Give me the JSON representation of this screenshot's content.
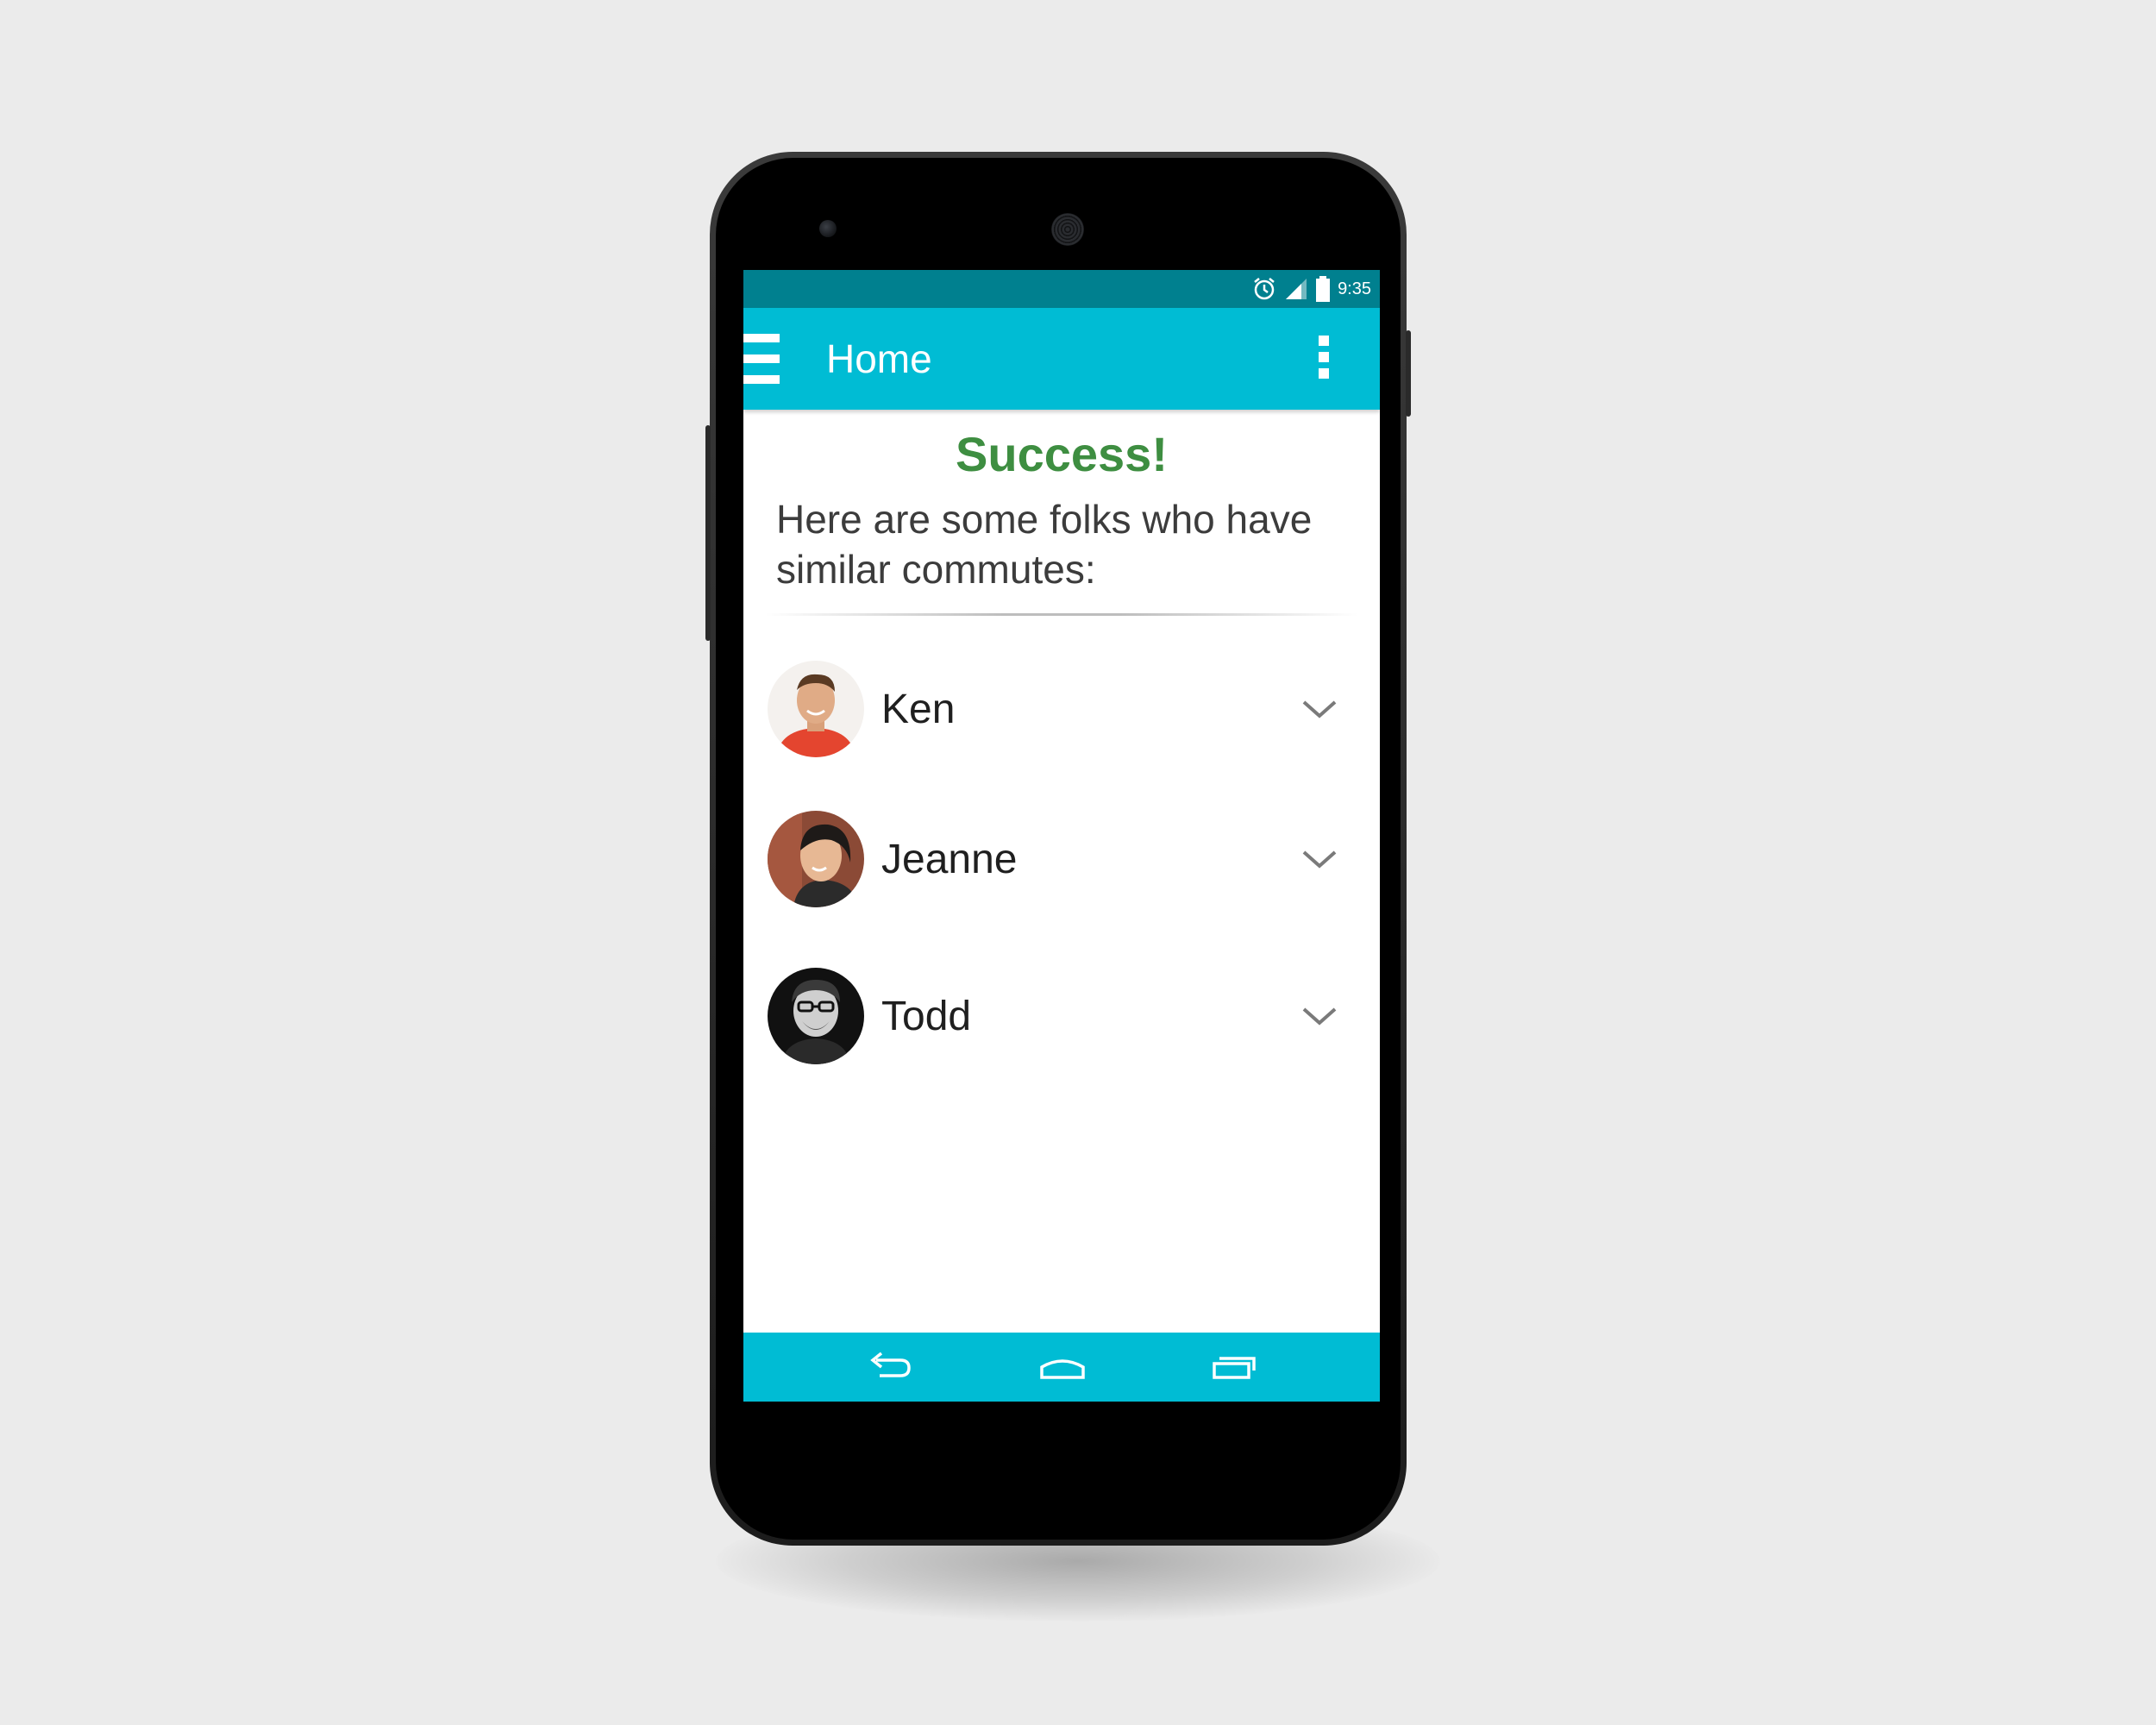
{
  "status_bar": {
    "time": "9:35",
    "icons": [
      "alarm-icon",
      "signal-icon",
      "battery-icon"
    ]
  },
  "app_bar": {
    "title": "Home",
    "menu_icon": "hamburger-icon",
    "overflow_icon": "more-vert-icon"
  },
  "main": {
    "heading": "Success!",
    "intro": "Here are some folks who have similar commutes:",
    "people": [
      {
        "name": "Ken"
      },
      {
        "name": "Jeanne"
      },
      {
        "name": "Todd"
      }
    ]
  },
  "nav_bar": {
    "icons": [
      "back-icon",
      "home-icon",
      "recents-icon"
    ]
  },
  "colors": {
    "status_bar": "#00808f",
    "app_bar": "#00bcd4",
    "heading": "#3e8e41",
    "background": "#ebebeb"
  }
}
